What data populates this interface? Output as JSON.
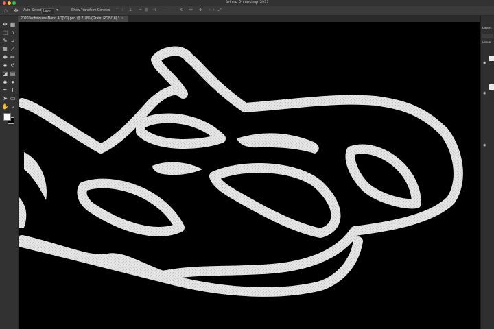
{
  "window": {
    "title": "Adobe Photoshop 2022"
  },
  "options_bar": {
    "auto_select_label": "Auto-Select:",
    "auto_select_value": "Layer",
    "show_transform_label": "Show Transform Controls"
  },
  "document": {
    "tab_label": "2020Techniques-Nono.AD(V3).psd @ 218% (Grain, RGB/16) *"
  },
  "tools": [
    {
      "name": "move-tool-icon",
      "glyph": "✥"
    },
    {
      "name": "artboard-tool-icon",
      "glyph": "▦"
    },
    {
      "name": "marquee-tool-icon",
      "glyph": "⬚"
    },
    {
      "name": "lasso-tool-icon",
      "glyph": "ↄ"
    },
    {
      "name": "quick-select-icon",
      "glyph": "✎"
    },
    {
      "name": "crop-tool-icon",
      "glyph": "⌗"
    },
    {
      "name": "frame-tool-icon",
      "glyph": "⊠"
    },
    {
      "name": "eyedropper-icon",
      "glyph": "⟋"
    },
    {
      "name": "healing-brush-icon",
      "glyph": "✚"
    },
    {
      "name": "brush-tool-icon",
      "glyph": "✏"
    },
    {
      "name": "clone-stamp-icon",
      "glyph": "♣"
    },
    {
      "name": "history-brush-icon",
      "glyph": "↺"
    },
    {
      "name": "eraser-tool-icon",
      "glyph": "◪"
    },
    {
      "name": "gradient-tool-icon",
      "glyph": "▤"
    },
    {
      "name": "blur-tool-icon",
      "glyph": "◆"
    },
    {
      "name": "dodge-tool-icon",
      "glyph": "●"
    },
    {
      "name": "pen-tool-icon",
      "glyph": "✒"
    },
    {
      "name": "type-tool-icon",
      "glyph": "T"
    },
    {
      "name": "path-select-icon",
      "glyph": "➤"
    },
    {
      "name": "shape-tool-icon",
      "glyph": "▭"
    },
    {
      "name": "hand-tool-icon",
      "glyph": "✋"
    },
    {
      "name": "zoom-tool-icon",
      "glyph": "⌕"
    }
  ],
  "panels": {
    "layers_tab": "Layers",
    "filter_label": "Linear"
  },
  "colors": {
    "foreground": "#ffffff",
    "background": "#000000",
    "artwork_fill": "#e6e6e6",
    "canvas": "#000000"
  }
}
